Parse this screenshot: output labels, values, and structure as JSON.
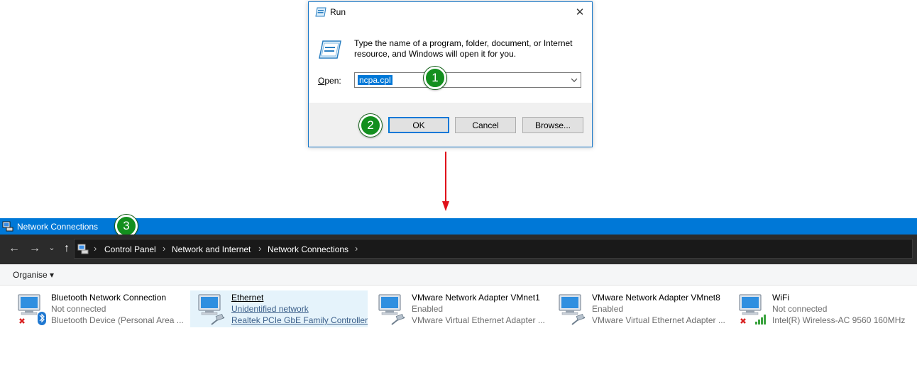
{
  "run_dialog": {
    "title": "Run",
    "close_glyph": "✕",
    "description": "Type the name of a program, folder, document, or Internet resource, and Windows will open it for you.",
    "open_label": "Open:",
    "open_value": "ncpa.cpl",
    "buttons": {
      "ok": "OK",
      "cancel": "Cancel",
      "browse": "Browse..."
    }
  },
  "callouts": [
    "1",
    "2",
    "3"
  ],
  "arrow": {
    "color": "#e0121b"
  },
  "network_window": {
    "title": "Network Connections",
    "nav": {
      "back": "←",
      "forward": "→",
      "recent": "⌄",
      "up": "↑"
    },
    "breadcrumb": [
      "Control Panel",
      "Network and Internet",
      "Network Connections"
    ],
    "toolbar": {
      "organise": "Organise ▾"
    },
    "adapters": [
      {
        "name": "Bluetooth Network Connection",
        "status": "Not connected",
        "device": "Bluetooth Device (Personal Area ...",
        "icon": "network-computer-icon",
        "overlay": "bluetooth-icon",
        "disconnected": true
      },
      {
        "name": "Ethernet",
        "status": "Unidentified network",
        "device": "Realtek PCIe GbE Family Controller",
        "icon": "network-computer-icon",
        "overlay": "ethernet-cable-icon",
        "selected": true
      },
      {
        "name": "VMware Network Adapter VMnet1",
        "status": "Enabled",
        "device": "VMware Virtual Ethernet Adapter ...",
        "icon": "network-computer-icon",
        "overlay": "ethernet-cable-icon"
      },
      {
        "name": "VMware Network Adapter VMnet8",
        "status": "Enabled",
        "device": "VMware Virtual Ethernet Adapter ...",
        "icon": "network-computer-icon",
        "overlay": "ethernet-cable-icon"
      },
      {
        "name": "WiFi",
        "status": "Not connected",
        "device": "Intel(R) Wireless-AC 9560 160MHz",
        "icon": "network-computer-icon",
        "overlay": "wifi-signal-icon",
        "disconnected": true
      }
    ]
  },
  "colors": {
    "titlebar_blue": "#0078d7",
    "callout_green": "#138f1e",
    "selection_bg": "#e5f3fb"
  }
}
